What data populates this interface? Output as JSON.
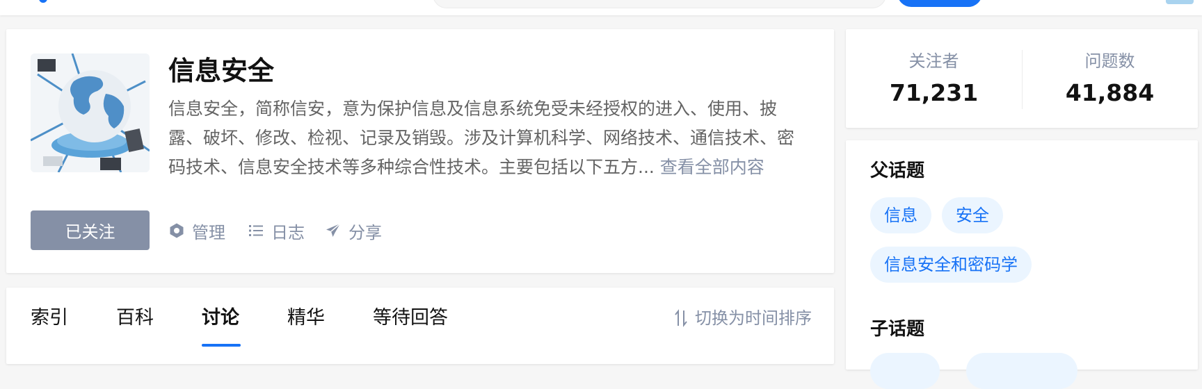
{
  "topic": {
    "title": "信息安全",
    "description": "信息安全，简称信安，意为保护信息及信息系统免受未经授权的进入、使用、披露、破坏、修改、检视、记录及销毁。涉及计算机科学、网络技术、通信技术、密码技术、信息安全技术等多种综合性技术。主要包括以下五方...",
    "read_more": "查看全部内容",
    "follow_label": "已关注",
    "actions": {
      "manage": "管理",
      "log": "日志",
      "share": "分享"
    }
  },
  "tabs": [
    {
      "label": "索引"
    },
    {
      "label": "百科"
    },
    {
      "label": "讨论",
      "active": true
    },
    {
      "label": "精华"
    },
    {
      "label": "等待回答"
    }
  ],
  "sort_toggle": "切换为时间排序",
  "stats": {
    "followers_label": "关注者",
    "followers_value": "71,231",
    "questions_label": "问题数",
    "questions_value": "41,884"
  },
  "related": {
    "parent_title": "父话题",
    "parents": [
      "信息",
      "安全",
      "信息安全和密码学"
    ],
    "child_title": "子话题"
  },
  "colors": {
    "accent": "#1772f6",
    "muted": "#8590a6",
    "chip_bg": "#ebf5ff"
  },
  "icons": {
    "manage": "hexagon-gear-icon",
    "log": "list-icon",
    "share": "paper-plane-icon",
    "sort": "sort-arrows-icon"
  }
}
